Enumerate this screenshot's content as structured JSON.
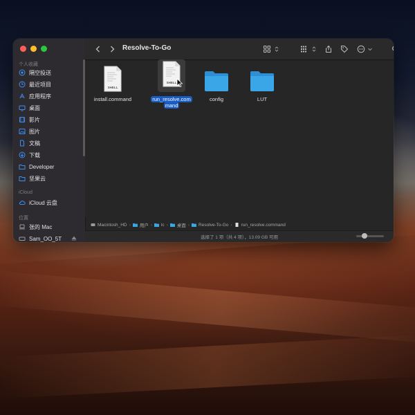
{
  "window": {
    "title": "Resolve-To-Go"
  },
  "sidebar": {
    "favorites_header": "个人收藏",
    "favorites": [
      {
        "label": "隔空投送",
        "icon": "airdrop-icon"
      },
      {
        "label": "最近项目",
        "icon": "clock-icon"
      },
      {
        "label": "应用程序",
        "icon": "applications-icon"
      },
      {
        "label": "桌面",
        "icon": "desktop-icon"
      },
      {
        "label": "影片",
        "icon": "film-icon"
      },
      {
        "label": "图片",
        "icon": "pictures-icon"
      },
      {
        "label": "文稿",
        "icon": "document-icon"
      },
      {
        "label": "下载",
        "icon": "download-icon"
      },
      {
        "label": "Developer",
        "icon": "folder-icon"
      },
      {
        "label": "坚果云",
        "icon": "folder-icon"
      }
    ],
    "icloud_header": "iCloud",
    "icloud": [
      {
        "label": "iCloud 云盘",
        "icon": "cloud-icon"
      }
    ],
    "locations_header": "位置",
    "locations": [
      {
        "label": "张的 Mac",
        "icon": "laptop-icon"
      },
      {
        "label": "Sam_OO_5T",
        "icon": "drive-icon"
      }
    ]
  },
  "files": [
    {
      "name_line1": "install.command",
      "name_line2": "",
      "type": "shell",
      "badge": "SHELL",
      "selected": false
    },
    {
      "name_line1": "run_resolve.com",
      "name_line2": "mand",
      "type": "shell",
      "badge": "SHELL",
      "selected": true
    },
    {
      "name_line1": "config",
      "name_line2": "",
      "type": "folder",
      "selected": false
    },
    {
      "name_line1": "LUT",
      "name_line2": "",
      "type": "folder",
      "selected": false
    }
  ],
  "pathbar": [
    "Macintosh_HD",
    "用户",
    "lc",
    "桌面",
    "Resolve-To-Go",
    "run_resolve.command"
  ],
  "status": "选择了 1 项（共 4 项），13.09 GB 可用",
  "colors": {
    "accent": "#1a5bc4",
    "folder": "#3aa6e8",
    "window_bg": "#262626",
    "sidebar_bg": "#2d2b2f"
  }
}
